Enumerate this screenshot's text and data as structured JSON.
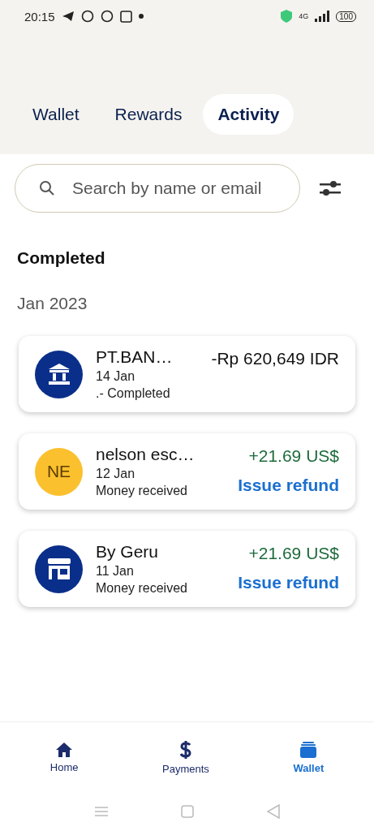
{
  "status_bar": {
    "time": "20:15",
    "network": "4G",
    "battery": "100"
  },
  "tabs": [
    {
      "label": "Wallet",
      "selected": false
    },
    {
      "label": "Rewards",
      "selected": false
    },
    {
      "label": "Activity",
      "selected": true
    }
  ],
  "search": {
    "placeholder": "Search by name or email"
  },
  "section_title": "Completed",
  "month": "Jan 2023",
  "transactions": [
    {
      "avatar": {
        "kind": "bank"
      },
      "name": "PT.BAN…",
      "date": "14 Jan",
      "status": ".- Completed",
      "amount": "-Rp 620,649 IDR",
      "credit": false
    },
    {
      "avatar": {
        "kind": "initials",
        "text": "NE"
      },
      "name": "nelson esc…",
      "date": "12 Jan",
      "status": "Money received",
      "amount": "+21.69 US$",
      "credit": true,
      "action": "Issue refund"
    },
    {
      "avatar": {
        "kind": "store"
      },
      "name": "By Geru",
      "date": "11 Jan",
      "status": "Money received",
      "amount": "+21.69 US$",
      "credit": true,
      "action": "Issue refund"
    }
  ],
  "bottom_nav": [
    {
      "kind": "home",
      "label": "Home",
      "selected": false
    },
    {
      "kind": "payments",
      "label": "Payments",
      "selected": false
    },
    {
      "kind": "wallet",
      "label": "Wallet",
      "selected": true
    }
  ]
}
